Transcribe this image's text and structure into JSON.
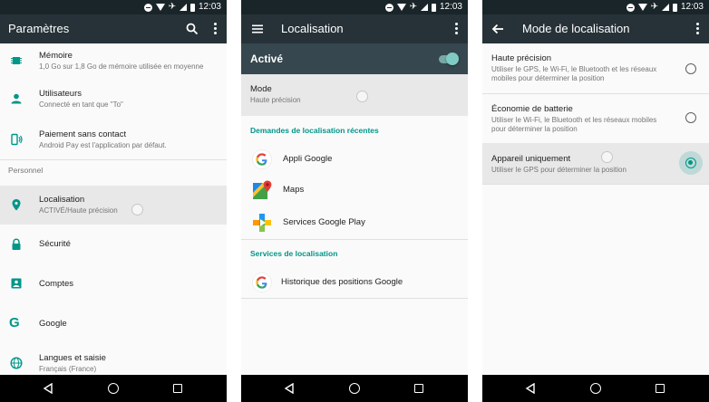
{
  "status_bar": {
    "time": "12:03"
  },
  "colors": {
    "accent": "#009688",
    "appbar": "#263238",
    "master_bar": "#37474f",
    "status_bar": "#1a252a"
  },
  "screen1": {
    "title": "Paramètres",
    "items_top": [
      {
        "icon": "memory-chip-icon",
        "title": "Mémoire",
        "subtitle": "1,0 Go sur 1,8 Go de mémoire utilisée en moyenne"
      },
      {
        "icon": "person-icon",
        "title": "Utilisateurs",
        "subtitle": "Connecté en tant que \"To\""
      },
      {
        "icon": "tap-and-pay-icon",
        "title": "Paiement sans contact",
        "subtitle": "Android Pay est l'application par défaut."
      }
    ],
    "section_personal": "Personnel",
    "items_personal": [
      {
        "icon": "location-pin-icon",
        "title": "Localisation",
        "subtitle": "ACTIVÉ/Haute précision"
      },
      {
        "icon": "lock-icon",
        "title": "Sécurité",
        "subtitle": ""
      },
      {
        "icon": "account-box-icon",
        "title": "Comptes",
        "subtitle": ""
      },
      {
        "icon": "google-g-icon",
        "title": "Google",
        "subtitle": ""
      },
      {
        "icon": "globe-icon",
        "title": "Langues et saisie",
        "subtitle": "Français (France)"
      }
    ]
  },
  "screen2": {
    "title": "Localisation",
    "master_label": "Activé",
    "master_on": true,
    "mode_title": "Mode",
    "mode_value": "Haute précision",
    "recent_header": "Demandes de localisation récentes",
    "recent_apps": [
      {
        "icon": "google-g-icon",
        "label": "Appli Google"
      },
      {
        "icon": "maps-icon",
        "label": "Maps"
      },
      {
        "icon": "play-services-icon",
        "label": "Services Google Play"
      }
    ],
    "services_header": "Services de localisation",
    "services": [
      {
        "icon": "google-g-icon",
        "label": "Historique des positions Google"
      }
    ]
  },
  "screen3": {
    "title": "Mode de localisation",
    "options": [
      {
        "title": "Haute précision",
        "desc": "Utiliser le GPS, le Wi-Fi, le Bluetooth et les réseaux mobiles pour déterminer la position",
        "selected": false
      },
      {
        "title": "Économie de batterie",
        "desc": "Utiliser le Wi-Fi, le Bluetooth et les réseaux mobiles pour déterminer la position",
        "selected": false
      },
      {
        "title": "Appareil uniquement",
        "desc": "Utiliser le GPS pour déterminer la position",
        "selected": true
      }
    ]
  }
}
